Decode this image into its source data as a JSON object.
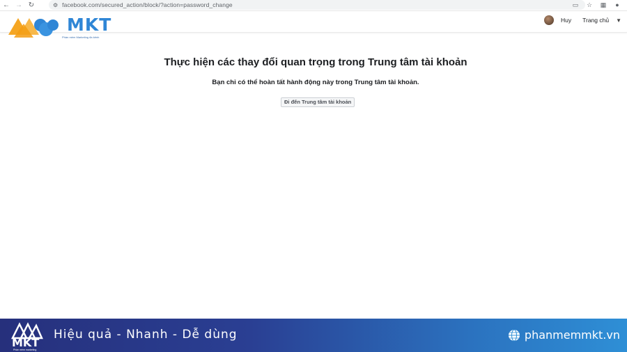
{
  "browser": {
    "url": "facebook.com/secured_action/block/?action=password_change"
  },
  "header": {
    "logo_text": "MKT",
    "logo_tagline": "Phần mềm Marketing đa kênh",
    "user_name": "Huy",
    "home_label": "Trang chủ"
  },
  "main": {
    "title": "Thực hiện các thay đổi quan trọng trong Trung tâm tài khoản",
    "subtitle": "Bạn chỉ có thể hoàn tất hành động này trong Trung tâm tài khoản.",
    "button_label": "Đi đến Trung tâm tài khoản"
  },
  "banner": {
    "logo_text": "MKT",
    "logo_tagline": "Phần mềm marketing",
    "slogan": "Hiệu quả - Nhanh  - Dễ dùng",
    "website": "phanmemmkt.vn"
  },
  "colors": {
    "mkt_orange": "#f5a623",
    "mkt_blue": "#2f86d6",
    "banner_start": "#26307c",
    "banner_end": "#2e8fd6"
  }
}
